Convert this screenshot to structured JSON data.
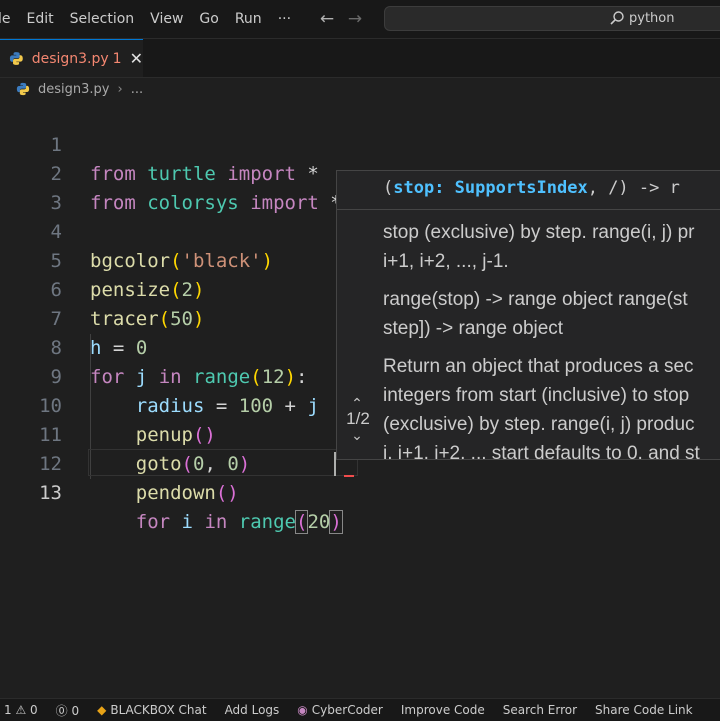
{
  "menubar": {
    "items": [
      "le",
      "Edit",
      "Selection",
      "View",
      "Go",
      "Run",
      "···"
    ],
    "back_icon": "arrow-left-icon",
    "forward_icon": "arrow-right-icon",
    "search_text": "python"
  },
  "tab": {
    "label": "design3.py",
    "problem_count": "1",
    "close_glyph": "✕"
  },
  "breadcrumb": {
    "file": "design3.py",
    "separator": "›",
    "more": "..."
  },
  "editor": {
    "line_numbers": [
      "1",
      "2",
      "3",
      "4",
      "5",
      "6",
      "7",
      "8",
      "9",
      "10",
      "11",
      "12",
      "13"
    ],
    "active_line": "13"
  },
  "signature_help": {
    "signature_open": "(",
    "active_param": "stop: SupportsIndex",
    "signature_rest": ", /) -> r",
    "doc_lines": [
      "stop (exclusive) by step. range(i, j) pr",
      "i+1, i+2, ..., j-1.",
      "range(stop) -> range object range(st",
      "step]) -> range object",
      "Return an object that produces a sec",
      "integers from start (inclusive) to stop",
      "(exclusive) by step. range(i, j) produc",
      "i, i+1, i+2, ... start defaults to 0, and st"
    ],
    "overload_counter": "1/2",
    "prev_glyph": "⌃",
    "next_glyph": "⌄"
  },
  "statusbar": {
    "items": [
      "1 ⚠ 0",
      "⓪ 0",
      "BLACKBOX Chat",
      "Add Logs",
      "CyberCoder",
      "Improve Code",
      "Search Error",
      "Share Code Link"
    ]
  },
  "colors": {
    "keyword": "#c586c0",
    "module": "#4ec9b0",
    "function": "#dcdcaa",
    "string": "#ce9178",
    "number": "#b5cea8",
    "variable": "#9cdcfe",
    "error": "#f48771",
    "accent": "#0078d4"
  }
}
